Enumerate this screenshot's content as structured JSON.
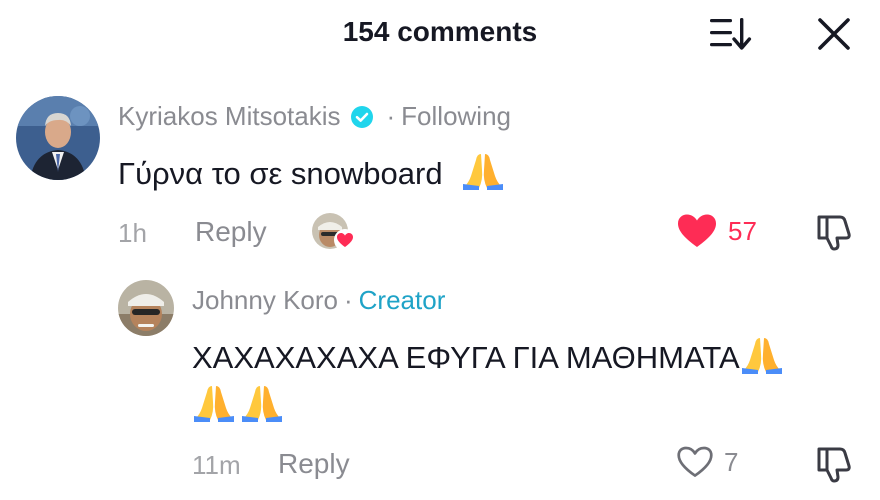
{
  "header": {
    "title": "154 comments"
  },
  "comments": [
    {
      "username": "Kyriakos Mitsotakis",
      "verified": true,
      "relation": "Following",
      "text": "Γύρνα το σε snowboard",
      "time": "1h",
      "reply_label": "Reply",
      "liked": true,
      "likes": "57",
      "like_color": "#fe2c55"
    },
    {
      "username": "Johnny Koro",
      "relation": "Creator",
      "text_line1": "ΧΑΧΑΧΑΧΑΧΑ ΕΦΥΓΑ ΓΙΑ ΜΑΘΗΜΑΤΑ",
      "time": "11m",
      "reply_label": "Reply",
      "liked": false,
      "likes": "7",
      "relation_color": "#1fa3c7"
    }
  ],
  "icons": [
    "sort-icon",
    "close-icon",
    "verified-icon",
    "pray-emoji-icon",
    "heart-icon",
    "dislike-icon"
  ]
}
